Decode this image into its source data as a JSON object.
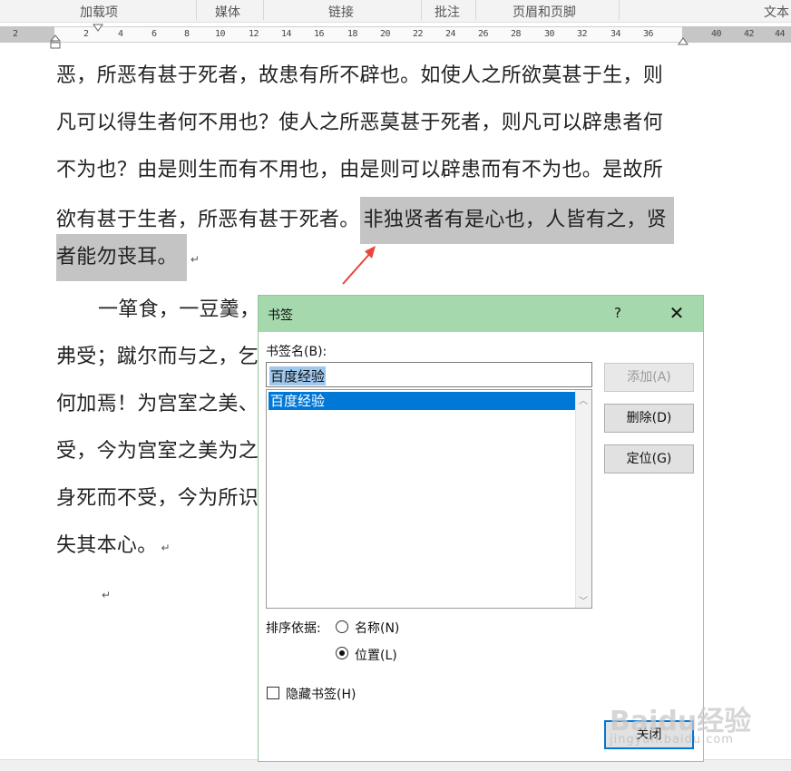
{
  "ribbon": {
    "groups": [
      "加载项",
      "媒体",
      "链接",
      "批注",
      "页眉和页脚",
      "文本"
    ]
  },
  "ruler": {
    "ticks": [
      "2",
      "2",
      "4",
      "6",
      "8",
      "10",
      "12",
      "14",
      "16",
      "18",
      "20",
      "22",
      "24",
      "26",
      "28",
      "30",
      "32",
      "34",
      "36",
      "40",
      "42",
      "44"
    ]
  },
  "document": {
    "lines": [
      "恶，所恶有甚于死者，故患有所不辟也。如使人之所欲莫甚于生，则",
      "凡可以得生者何不用也？使人之所恶莫甚于死者，则凡可以辟患者何",
      "不为也？由是则生而有不用也，由是则可以辟患而有不为也。是故所",
      "欲有甚于生者，所恶有甚于死者。",
      "非独贤者有是心也，人皆有之，贤",
      "者能勿丧耳。",
      "一箪食，一豆羹，",
      "弗受；蹴尔而与之，乞",
      "何加焉！为宫室之美、",
      "受，今为宫室之美为之",
      "身死而不受，今为所识",
      "失其本心。"
    ],
    "para_mark": "↵"
  },
  "dialog": {
    "title": "书签",
    "help": "?",
    "close": "✕",
    "name_label": "书签名(B):",
    "name_value": "百度经验",
    "list_items": [
      "百度经验"
    ],
    "buttons": {
      "add": "添加(A)",
      "delete": "删除(D)",
      "goto": "定位(G)",
      "close": "关闭"
    },
    "sort_label": "排序依据:",
    "sort_options": {
      "name": "名称(N)",
      "location": "位置(L)"
    },
    "sort_selected": "location",
    "hidden_label": "隐藏书签(H)",
    "hidden_checked": false
  },
  "watermark": {
    "brand": "Baidu经验",
    "url": "jingyan.baidu.com"
  },
  "colors": {
    "title_bar": "#a5d8ac",
    "selection": "#0078d7",
    "highlight": "#c4c4c4",
    "arrow": "#e8463b"
  }
}
